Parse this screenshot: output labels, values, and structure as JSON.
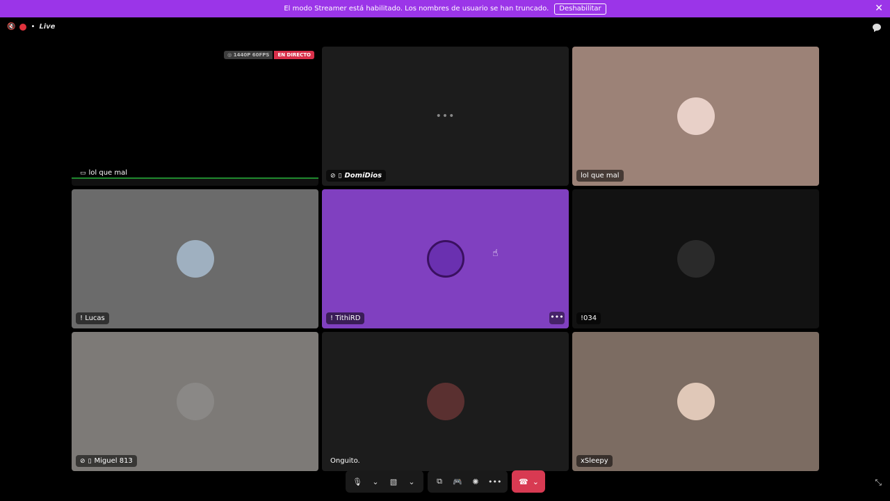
{
  "banner": {
    "message": "El modo Streamer está habilitado. Los nombres de usuario se han truncado.",
    "button_label": "Deshabilitar",
    "close_glyph": "✕",
    "bg_color": "#9b35e8"
  },
  "topbar": {
    "speaker_glyph": "🔇",
    "status_dot_glyph": "•",
    "live_label": "Live"
  },
  "stream_tile": {
    "quality_badge": "◎ 1440P 60FPS",
    "live_badge": "EN DIRECTO",
    "name": "lol que mal",
    "name_icon": "screen-share-icon"
  },
  "tiles": [
    {
      "name": "DomiDios",
      "icons": [
        "muted-mic-icon",
        "mobile-icon"
      ],
      "bg": "#1c1c1c",
      "loading_glyph": "•••"
    },
    {
      "name": "lol que mal",
      "bg": "#9c8277",
      "avatar": "#e8d0c8"
    },
    {
      "name": "! Lucas",
      "bg": "#6b6b6b",
      "avatar": "#9fb0c0"
    },
    {
      "name": "! TithiRD",
      "bg": "#8040c0",
      "avatar": "#6a30b0",
      "more_glyph": "•••"
    },
    {
      "name": "!034",
      "bg": "#121212",
      "avatar": "#2a2a2a"
    },
    {
      "name": "Miguel 813",
      "icons": [
        "muted-mic-icon",
        "mobile-icon"
      ],
      "bg": "#7d7a77",
      "avatar": "#8a8886"
    },
    {
      "name": "Onguito.",
      "bg": "#1c1c1c",
      "avatar": "#5a3030"
    },
    {
      "name": "xSleepy",
      "bg": "#7c6c62",
      "avatar": "#e0c8b8"
    }
  ],
  "controls": {
    "mic_glyph": "🎙",
    "chevron_glyph": "⌄",
    "camera_glyph": "▧",
    "screen_share_glyph": "⧉",
    "activity_glyph": "🎮",
    "soundboard_glyph": "✺",
    "more_glyph": "•••",
    "hangup_glyph": "☎",
    "shrink_glyph": "⤡"
  }
}
